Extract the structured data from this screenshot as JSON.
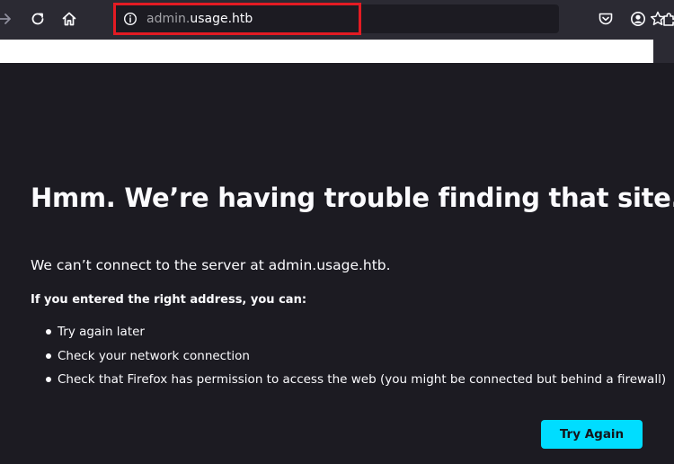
{
  "address_bar": {
    "url_subdomain": "admin.",
    "url_domain": "usage.htb"
  },
  "icons": {
    "back": "back-arrow-icon",
    "reload": "reload-icon",
    "home": "home-icon",
    "info": "site-info-icon",
    "bookmark": "bookmark-star-icon",
    "pocket": "pocket-icon",
    "account": "account-icon",
    "extensions": "extensions-puzzle-icon"
  },
  "colors": {
    "toolbar": "#2b2a33",
    "page_background": "#1c1b22",
    "text": "#fbfbfe",
    "primary_button": "#00ddff",
    "highlight_box": "#e31b23"
  },
  "error_page": {
    "title": "Hmm. We’re having trouble finding that site.",
    "description": "We can’t connect to the server at admin.usage.htb.",
    "hint": "If you entered the right address, you can:",
    "suggestions": [
      "Try again later",
      "Check your network connection",
      "Check that Firefox has permission to access the web (you might be connected but behind a firewall)"
    ],
    "button_label": "Try Again"
  }
}
